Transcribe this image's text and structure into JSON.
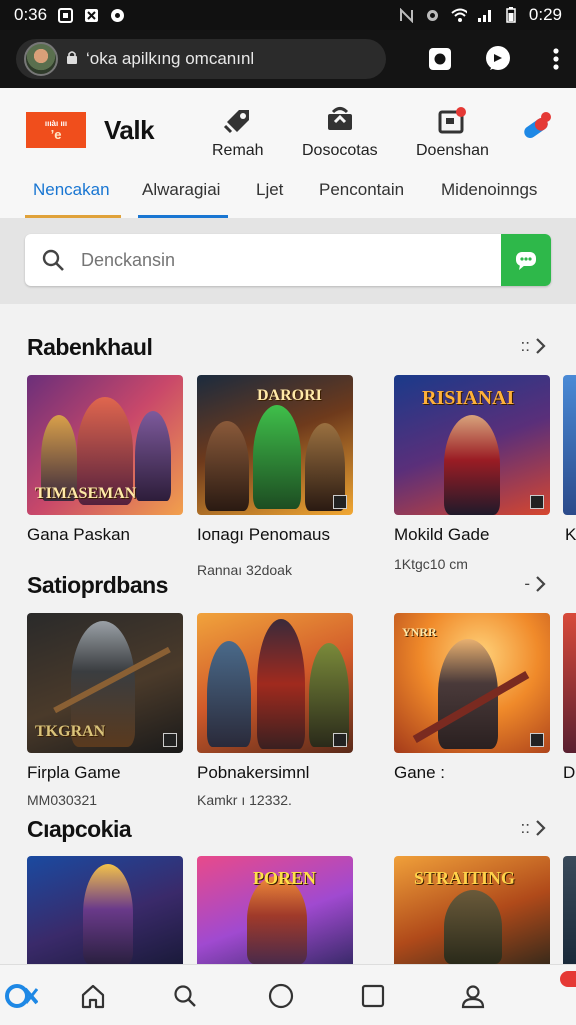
{
  "status_bar": {
    "time_left": "0:36",
    "time_right": "0:29"
  },
  "browser": {
    "url_text": "‘oka apilkıng omcanınl"
  },
  "app": {
    "logo_line1": "ıııàı ııı",
    "logo_line2": "’e",
    "brand": "Valk",
    "actions": [
      {
        "label": "Remah",
        "icon": "pencil-tag-icon"
      },
      {
        "label": "Dosocotas",
        "icon": "refresh-box-icon"
      },
      {
        "label": "Doenshan",
        "icon": "notification-box-icon"
      }
    ]
  },
  "tabs": [
    {
      "label": "Nencakan",
      "active": true
    },
    {
      "label": "Alwaragiai",
      "active": false
    },
    {
      "label": "Ljet",
      "active": false
    },
    {
      "label": "Pencontain",
      "active": false
    },
    {
      "label": "Midenoinngs",
      "active": false
    }
  ],
  "search": {
    "placeholder": "Denckansin"
  },
  "sections": [
    {
      "title": "Rabenkhaul",
      "more": "::",
      "cards": [
        {
          "title": "Gana Paskan",
          "sub": "",
          "caption": "TIMASEMAN"
        },
        {
          "title": "Iопаgı Penomaus",
          "sub": "Rannaı 32doak",
          "caption": "DARORI"
        },
        {
          "title": "Mokild Gade",
          "sub": "1Ktgc10 cm",
          "caption": "RISIANAI"
        },
        {
          "title": "K",
          "sub": "",
          "caption": ""
        }
      ]
    },
    {
      "title": "Satioprdbans",
      "more": "-",
      "cards": [
        {
          "title": "Firpla Game",
          "sub": "MM030321",
          "caption": "TKGRAN"
        },
        {
          "title": "Pobnakersimnl",
          "sub": "Kamkr ı 12332.",
          "caption": ""
        },
        {
          "title": "Gane :",
          "sub": "",
          "caption": "YNRR"
        },
        {
          "title": "D",
          "sub": "",
          "caption": ""
        }
      ]
    },
    {
      "title": "Cıapcokia",
      "more": "::",
      "cards": [
        {
          "title": "",
          "sub": "",
          "caption": ""
        },
        {
          "title": "",
          "sub": "",
          "caption": "POREN"
        },
        {
          "title": "",
          "sub": "",
          "caption": "STRAITING"
        },
        {
          "title": "",
          "sub": "",
          "caption": ""
        }
      ]
    }
  ],
  "bottom_nav": [
    "brand-icon",
    "home-icon",
    "search-icon",
    "circle-icon",
    "square-icon",
    "profile-icon"
  ],
  "colors": {
    "accent_blue": "#1976d2",
    "search_green": "#2eb84a",
    "logo_orange": "#f04e1c"
  }
}
